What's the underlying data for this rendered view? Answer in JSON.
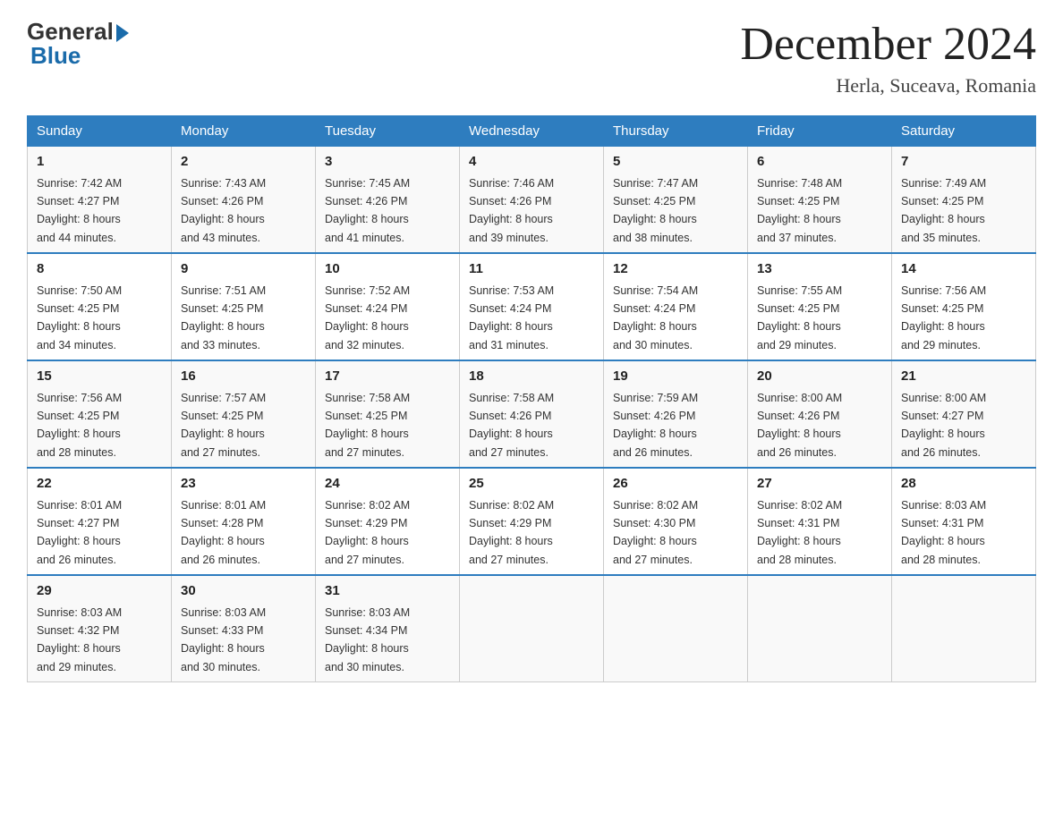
{
  "header": {
    "logo_general": "General",
    "logo_blue": "Blue",
    "month_title": "December 2024",
    "location": "Herla, Suceava, Romania"
  },
  "days_of_week": [
    "Sunday",
    "Monday",
    "Tuesday",
    "Wednesday",
    "Thursday",
    "Friday",
    "Saturday"
  ],
  "weeks": [
    [
      {
        "day": "1",
        "sunrise": "7:42 AM",
        "sunset": "4:27 PM",
        "daylight": "8 hours and 44 minutes."
      },
      {
        "day": "2",
        "sunrise": "7:43 AM",
        "sunset": "4:26 PM",
        "daylight": "8 hours and 43 minutes."
      },
      {
        "day": "3",
        "sunrise": "7:45 AM",
        "sunset": "4:26 PM",
        "daylight": "8 hours and 41 minutes."
      },
      {
        "day": "4",
        "sunrise": "7:46 AM",
        "sunset": "4:26 PM",
        "daylight": "8 hours and 39 minutes."
      },
      {
        "day": "5",
        "sunrise": "7:47 AM",
        "sunset": "4:25 PM",
        "daylight": "8 hours and 38 minutes."
      },
      {
        "day": "6",
        "sunrise": "7:48 AM",
        "sunset": "4:25 PM",
        "daylight": "8 hours and 37 minutes."
      },
      {
        "day": "7",
        "sunrise": "7:49 AM",
        "sunset": "4:25 PM",
        "daylight": "8 hours and 35 minutes."
      }
    ],
    [
      {
        "day": "8",
        "sunrise": "7:50 AM",
        "sunset": "4:25 PM",
        "daylight": "8 hours and 34 minutes."
      },
      {
        "day": "9",
        "sunrise": "7:51 AM",
        "sunset": "4:25 PM",
        "daylight": "8 hours and 33 minutes."
      },
      {
        "day": "10",
        "sunrise": "7:52 AM",
        "sunset": "4:24 PM",
        "daylight": "8 hours and 32 minutes."
      },
      {
        "day": "11",
        "sunrise": "7:53 AM",
        "sunset": "4:24 PM",
        "daylight": "8 hours and 31 minutes."
      },
      {
        "day": "12",
        "sunrise": "7:54 AM",
        "sunset": "4:24 PM",
        "daylight": "8 hours and 30 minutes."
      },
      {
        "day": "13",
        "sunrise": "7:55 AM",
        "sunset": "4:25 PM",
        "daylight": "8 hours and 29 minutes."
      },
      {
        "day": "14",
        "sunrise": "7:56 AM",
        "sunset": "4:25 PM",
        "daylight": "8 hours and 29 minutes."
      }
    ],
    [
      {
        "day": "15",
        "sunrise": "7:56 AM",
        "sunset": "4:25 PM",
        "daylight": "8 hours and 28 minutes."
      },
      {
        "day": "16",
        "sunrise": "7:57 AM",
        "sunset": "4:25 PM",
        "daylight": "8 hours and 27 minutes."
      },
      {
        "day": "17",
        "sunrise": "7:58 AM",
        "sunset": "4:25 PM",
        "daylight": "8 hours and 27 minutes."
      },
      {
        "day": "18",
        "sunrise": "7:58 AM",
        "sunset": "4:26 PM",
        "daylight": "8 hours and 27 minutes."
      },
      {
        "day": "19",
        "sunrise": "7:59 AM",
        "sunset": "4:26 PM",
        "daylight": "8 hours and 26 minutes."
      },
      {
        "day": "20",
        "sunrise": "8:00 AM",
        "sunset": "4:26 PM",
        "daylight": "8 hours and 26 minutes."
      },
      {
        "day": "21",
        "sunrise": "8:00 AM",
        "sunset": "4:27 PM",
        "daylight": "8 hours and 26 minutes."
      }
    ],
    [
      {
        "day": "22",
        "sunrise": "8:01 AM",
        "sunset": "4:27 PM",
        "daylight": "8 hours and 26 minutes."
      },
      {
        "day": "23",
        "sunrise": "8:01 AM",
        "sunset": "4:28 PM",
        "daylight": "8 hours and 26 minutes."
      },
      {
        "day": "24",
        "sunrise": "8:02 AM",
        "sunset": "4:29 PM",
        "daylight": "8 hours and 27 minutes."
      },
      {
        "day": "25",
        "sunrise": "8:02 AM",
        "sunset": "4:29 PM",
        "daylight": "8 hours and 27 minutes."
      },
      {
        "day": "26",
        "sunrise": "8:02 AM",
        "sunset": "4:30 PM",
        "daylight": "8 hours and 27 minutes."
      },
      {
        "day": "27",
        "sunrise": "8:02 AM",
        "sunset": "4:31 PM",
        "daylight": "8 hours and 28 minutes."
      },
      {
        "day": "28",
        "sunrise": "8:03 AM",
        "sunset": "4:31 PM",
        "daylight": "8 hours and 28 minutes."
      }
    ],
    [
      {
        "day": "29",
        "sunrise": "8:03 AM",
        "sunset": "4:32 PM",
        "daylight": "8 hours and 29 minutes."
      },
      {
        "day": "30",
        "sunrise": "8:03 AM",
        "sunset": "4:33 PM",
        "daylight": "8 hours and 30 minutes."
      },
      {
        "day": "31",
        "sunrise": "8:03 AM",
        "sunset": "4:34 PM",
        "daylight": "8 hours and 30 minutes."
      },
      null,
      null,
      null,
      null
    ]
  ],
  "labels": {
    "sunrise": "Sunrise:",
    "sunset": "Sunset:",
    "daylight": "Daylight:"
  }
}
